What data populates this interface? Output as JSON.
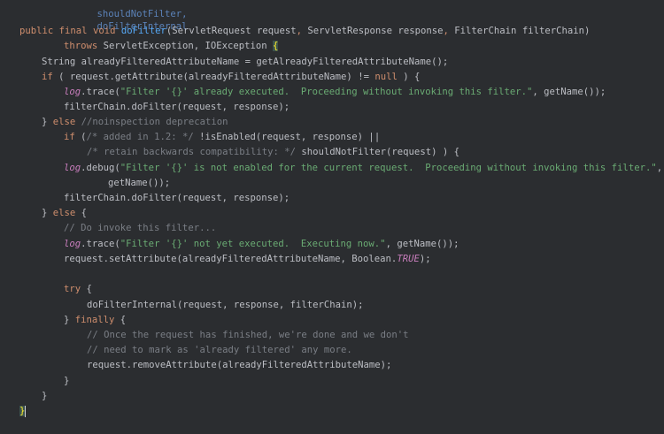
{
  "code": {
    "lines": [
      [
        "shouldNotFilter,"
      ],
      [
        "doFilterInternal"
      ],
      [
        "public",
        "final",
        "void",
        "doFilter",
        "(",
        "ServletRequest",
        "request",
        ", ",
        "ServletResponse",
        "response",
        ", ",
        "FilterChain",
        "filterChain",
        ")"
      ],
      [
        "throws",
        "ServletException, IOException",
        "{"
      ],
      [
        "String alreadyFilteredAttributeName = getAlreadyFilteredAttributeName();"
      ],
      [
        "if",
        "( request.getAttribute(alreadyFilteredAttributeName) != ",
        "null",
        " ) {"
      ],
      [
        "log",
        ".trace(",
        "\"Filter '{}' already executed.  Proceeding without invoking this filter.\"",
        ", getName());"
      ],
      [
        "filterChain.doFilter(request, response);"
      ],
      [
        "} ",
        "else",
        " //noinspection deprecation"
      ],
      [
        "if",
        " (",
        "/* added in 1.2: */",
        " !isEnabled(request, response) ||"
      ],
      [
        "/* retain backwards compatibility: */",
        " shouldNotFilter(request) ) {"
      ],
      [
        "log",
        ".debug(",
        "\"Filter '{}' is not enabled for the current request.  Proceeding without invoking this filter.\"",
        ","
      ],
      [
        "getName());"
      ],
      [
        "filterChain.doFilter(request, response);"
      ],
      [
        "} ",
        "else",
        " {"
      ],
      [
        "// Do invoke this filter..."
      ],
      [
        "log",
        ".trace(",
        "\"Filter '{}' not yet executed.  Executing now.\"",
        ", getName());"
      ],
      [
        "request.setAttribute(alreadyFilteredAttributeName, Boolean.",
        "TRUE",
        ");"
      ],
      [
        "try",
        " {"
      ],
      [
        "doFilterInternal(request, response, filterChain);"
      ],
      [
        "} ",
        "finally",
        " {"
      ],
      [
        "// Once the request has finished, we're done and we don't"
      ],
      [
        "// need to mark as 'already filtered' any more."
      ],
      [
        "request.removeAttribute(alreadyFilteredAttributeName);"
      ],
      [
        "}"
      ],
      [
        "}"
      ],
      [
        "}"
      ]
    ]
  },
  "colors": {
    "background": "#2b2d30",
    "keyword": "#cf8e6d",
    "method": "#56a8f5",
    "string": "#6aab73",
    "comment": "#7a7e85",
    "static_field": "#c77dbb",
    "text": "#bcbec4"
  }
}
